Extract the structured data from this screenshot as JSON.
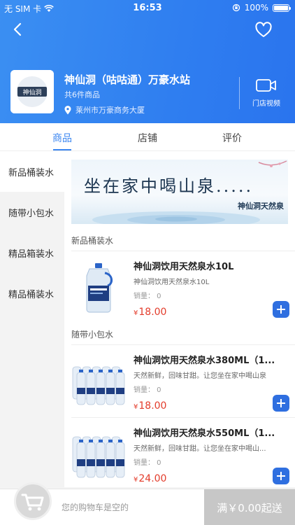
{
  "status_bar": {
    "carrier": "无 SIM 卡",
    "time": "16:53",
    "battery": "100%"
  },
  "store": {
    "logo_text": "神仙洞",
    "name": "神仙洞（咕咕通）万豪水站",
    "product_count": "共6件商品",
    "address": "莱州市万豪商务大厦",
    "video_label": "门店视频"
  },
  "tabs": [
    {
      "label": "商品",
      "active": true
    },
    {
      "label": "店铺",
      "active": false
    },
    {
      "label": "评价",
      "active": false
    }
  ],
  "sidebar": {
    "items": [
      {
        "label": "新品桶装水",
        "active": true
      },
      {
        "label": "随带小包水",
        "active": false
      },
      {
        "label": "精品箱装水",
        "active": false
      },
      {
        "label": "精品桶装水",
        "active": false
      }
    ]
  },
  "banner": {
    "headline": "坐在家中喝山泉.....",
    "brand": "神仙洞天然泉"
  },
  "sections": [
    {
      "title": "新品桶装水",
      "products": [
        {
          "name": "神仙洞饮用天然泉水10L",
          "desc": "神仙洞饮用天然泉水10L",
          "sales": "销量： 0",
          "currency": "¥",
          "price": "18.00",
          "image": "bucket-bottle"
        }
      ]
    },
    {
      "title": "随带小包水",
      "products": [
        {
          "name": "神仙洞饮用天然泉水380ML（1...",
          "desc": "天然新鲜，回味甘甜。让您坐在家中喝山泉",
          "sales": "销量： 0",
          "currency": "¥",
          "price": "18.00",
          "image": "bottle-pack"
        },
        {
          "name": "神仙洞饮用天然泉水550ML（1...",
          "desc": "天然新鲜，回味甘甜。让您坐在家中喝山...",
          "sales": "销量： 0",
          "currency": "¥",
          "price": "24.00",
          "image": "bottle-pack"
        }
      ]
    }
  ],
  "cart": {
    "empty_text": "您的购物车是空的",
    "checkout_label": "满￥0.00起送"
  },
  "colors": {
    "header": "#2f7ef0",
    "accent": "#3b86f0",
    "price": "#e33c2b",
    "add_button": "#2f6fe0"
  }
}
